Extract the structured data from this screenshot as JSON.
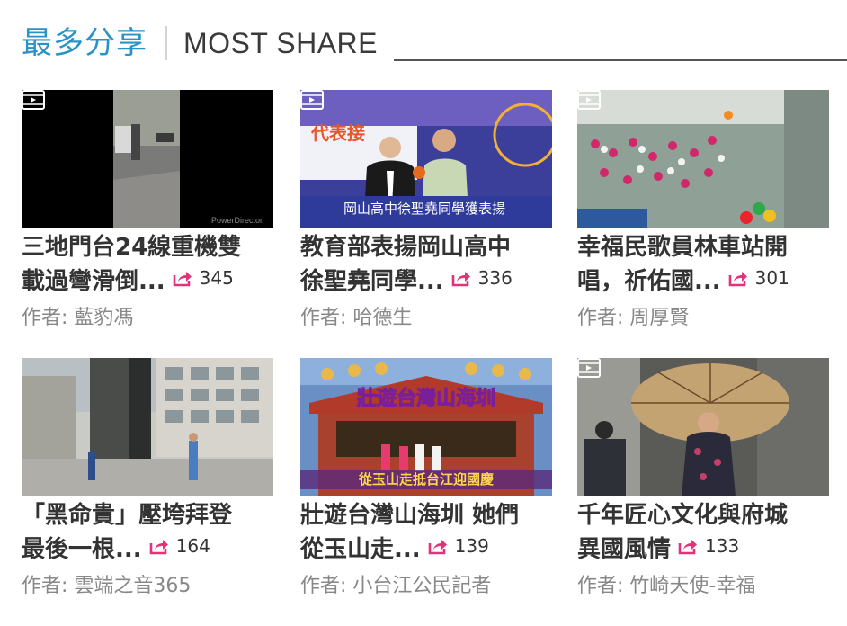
{
  "header": {
    "title_cn": "最多分享",
    "title_en": "MOST SHARE"
  },
  "share_icon": "share-arrow-icon",
  "accent_color": "#e2337a",
  "heading_color": "#2a92c7",
  "cards": [
    {
      "title_line1": "三地門台24線重機雙",
      "title_line2": "載過彎滑倒...",
      "share_count": "345",
      "author": "作者: 藍豹馮",
      "thumb_caption": "PowerDirector"
    },
    {
      "title_line1": "教育部表揚岡山高中",
      "title_line2": "徐聖堯同學...",
      "share_count": "336",
      "author": "作者: 哈德生",
      "thumb_caption": "岡山高中徐聖堯同學獲表揚"
    },
    {
      "title_line1": "幸福民歌員林車站開",
      "title_line2": "唱，祈佑國...",
      "share_count": "301",
      "author": "作者: 周厚賢",
      "thumb_caption": ""
    },
    {
      "title_line1": "「黑命貴」壓垮拜登",
      "title_line2": "最後一根...",
      "share_count": "164",
      "author": "作者: 雲端之音365",
      "thumb_caption": ""
    },
    {
      "title_line1": "壯遊台灣山海圳 她們",
      "title_line2": "從玉山走...",
      "share_count": "139",
      "author": "作者: 小台江公民記者",
      "thumb_caption": "壯遊台灣山海圳"
    },
    {
      "title_line1": "千年匠心文化與府城",
      "title_line2": "異國風情",
      "share_count": "133",
      "author": "作者: 竹崎天使-幸福",
      "thumb_caption": ""
    }
  ]
}
